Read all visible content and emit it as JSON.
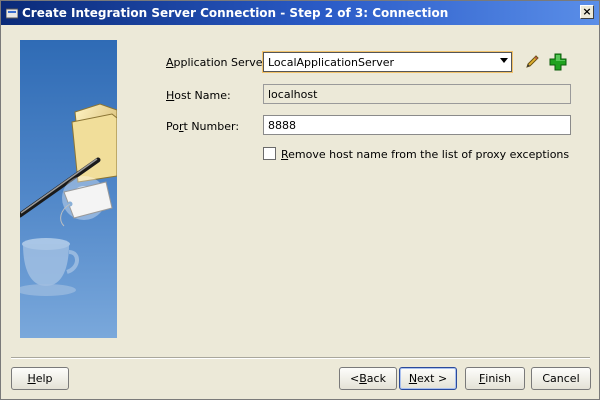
{
  "window": {
    "title": "Create Integration Server Connection - Step 2 of 3: Connection",
    "close_label": "×"
  },
  "form": {
    "app_server": {
      "label_pre": "",
      "label_u": "A",
      "label_post": "pplication Server:",
      "value": "LocalApplicationServer"
    },
    "host": {
      "label_pre": "",
      "label_u": "H",
      "label_post": "ost Name:",
      "value": "localhost"
    },
    "port": {
      "label_pre": "Po",
      "label_u": "r",
      "label_post": "t Number:",
      "value": "8888"
    },
    "proxy": {
      "label_pre": "",
      "label_u": "R",
      "label_post": "emove host name from the list of proxy exceptions",
      "checked": false
    }
  },
  "icons": {
    "edit": "pencil-icon",
    "add": "plus-icon",
    "wizard_art": "folder-wand-cup-illustration"
  },
  "buttons": {
    "help": {
      "pre": "",
      "u": "H",
      "post": "elp"
    },
    "back": {
      "pre": "< ",
      "u": "B",
      "post": "ack"
    },
    "next": {
      "pre": "",
      "u": "N",
      "post": "ext >"
    },
    "finish": {
      "pre": "",
      "u": "F",
      "post": "inish"
    },
    "cancel": {
      "pre": "Cancel",
      "u": "",
      "post": ""
    }
  },
  "colors": {
    "title_start": "#0a2a78",
    "title_end": "#5a8ee8",
    "dialog_bg": "#ece9d8",
    "add_green": "#1fa31f",
    "panel_blue": "#4f86c8"
  }
}
